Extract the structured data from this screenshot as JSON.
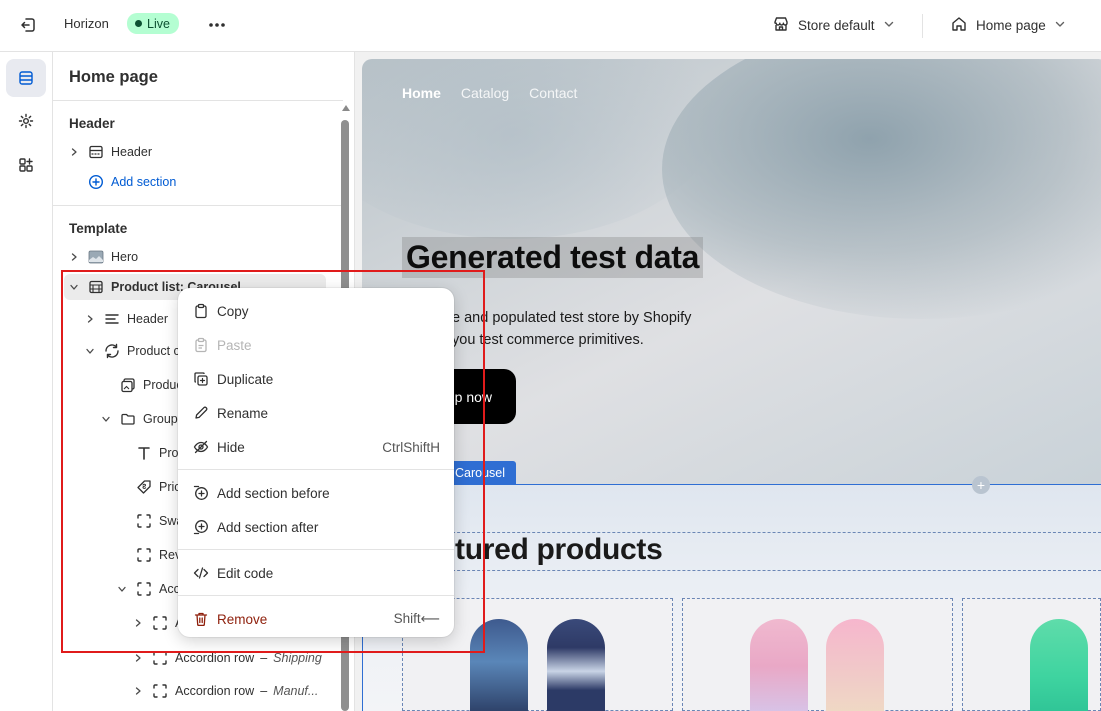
{
  "topbar": {
    "theme_name": "Horizon",
    "status_badge": "Live",
    "store_selector": "Store default",
    "page_selector": "Home page"
  },
  "sidebar": {
    "title": "Home page",
    "header_group": {
      "heading": "Header",
      "items": [
        {
          "label": "Header"
        }
      ],
      "add_section": "Add section"
    },
    "template_group": {
      "heading": "Template",
      "items": [
        {
          "label": "Hero"
        },
        {
          "label": "Product list: Carousel"
        },
        {
          "label": "Header"
        },
        {
          "label": "Product c"
        },
        {
          "label": "Produc"
        },
        {
          "label": "Group"
        },
        {
          "label": "Prod"
        },
        {
          "label": "Pric"
        },
        {
          "label": "Swa"
        },
        {
          "label": "Rev"
        },
        {
          "label": "Acco"
        },
        {
          "label": "A"
        },
        {
          "label": "Accordion row",
          "detail": "Shipping"
        },
        {
          "label": "Accordion row",
          "detail": "Manuf..."
        }
      ]
    }
  },
  "context_menu": {
    "items": [
      {
        "label": "Copy",
        "icon": "clipboard-icon"
      },
      {
        "label": "Paste",
        "icon": "paste-icon",
        "disabled": true
      },
      {
        "label": "Duplicate",
        "icon": "duplicate-icon"
      },
      {
        "label": "Rename",
        "icon": "pencil-icon"
      },
      {
        "label": "Hide",
        "icon": "eye-off-icon",
        "shortcut": "CtrlShiftH"
      },
      {
        "label": "Add section before",
        "icon": "add-section-before-icon"
      },
      {
        "label": "Add section after",
        "icon": "add-section-after-icon"
      },
      {
        "label": "Edit code",
        "icon": "code-icon"
      },
      {
        "label": "Remove",
        "icon": "trash-icon",
        "shortcut": "Shift⟵"
      }
    ]
  },
  "preview": {
    "nav": [
      "Home",
      "Catalog",
      "Contact"
    ],
    "hero_heading": "Generated test data",
    "hero_sub_line1": "e and populated test store by Shopify",
    "hero_sub_line2": "you test commerce primitives.",
    "hero_button": "p now",
    "section_tag": "Carousel",
    "featured_title": "tured products"
  },
  "colors": {
    "accent": "#005bd3",
    "live_badge": "#b4fed2",
    "selection_outline": "#2f6ed3",
    "danger": "#8e1f0b",
    "highlight_box": "#e01b1b"
  }
}
